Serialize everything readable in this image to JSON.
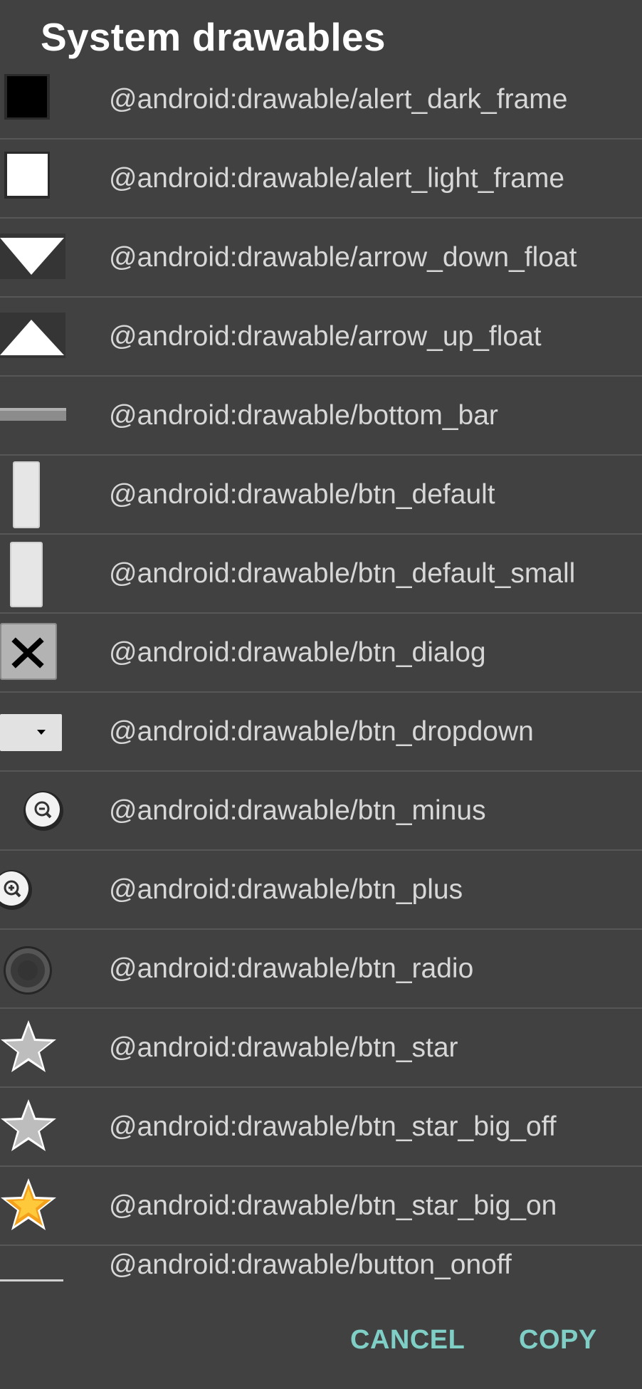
{
  "dialog": {
    "title": "System drawables",
    "items": [
      {
        "label": "@android:drawable/alert_dark_frame",
        "icon": "alert-dark-frame-icon"
      },
      {
        "label": "@android:drawable/alert_light_frame",
        "icon": "alert-light-frame-icon"
      },
      {
        "label": "@android:drawable/arrow_down_float",
        "icon": "arrow-down-float-icon"
      },
      {
        "label": "@android:drawable/arrow_up_float",
        "icon": "arrow-up-float-icon"
      },
      {
        "label": "@android:drawable/bottom_bar",
        "icon": "bottom-bar-icon"
      },
      {
        "label": "@android:drawable/btn_default",
        "icon": "btn-default-icon"
      },
      {
        "label": "@android:drawable/btn_default_small",
        "icon": "btn-default-small-icon"
      },
      {
        "label": "@android:drawable/btn_dialog",
        "icon": "btn-dialog-icon"
      },
      {
        "label": "@android:drawable/btn_dropdown",
        "icon": "btn-dropdown-icon"
      },
      {
        "label": "@android:drawable/btn_minus",
        "icon": "btn-minus-icon"
      },
      {
        "label": "@android:drawable/btn_plus",
        "icon": "btn-plus-icon"
      },
      {
        "label": "@android:drawable/btn_radio",
        "icon": "btn-radio-icon"
      },
      {
        "label": "@android:drawable/btn_star",
        "icon": "btn-star-icon"
      },
      {
        "label": "@android:drawable/btn_star_big_off",
        "icon": "btn-star-big-off-icon"
      },
      {
        "label": "@android:drawable/btn_star_big_on",
        "icon": "btn-star-big-on-icon"
      },
      {
        "label": "@android:drawable/button_onoff",
        "icon": "button-onoff-icon"
      }
    ],
    "cancel_label": "CANCEL",
    "copy_label": "COPY"
  },
  "colors": {
    "background": "#414141",
    "divider": "#575757",
    "text": "#d7d7d7",
    "accent": "#7fcfc6"
  }
}
